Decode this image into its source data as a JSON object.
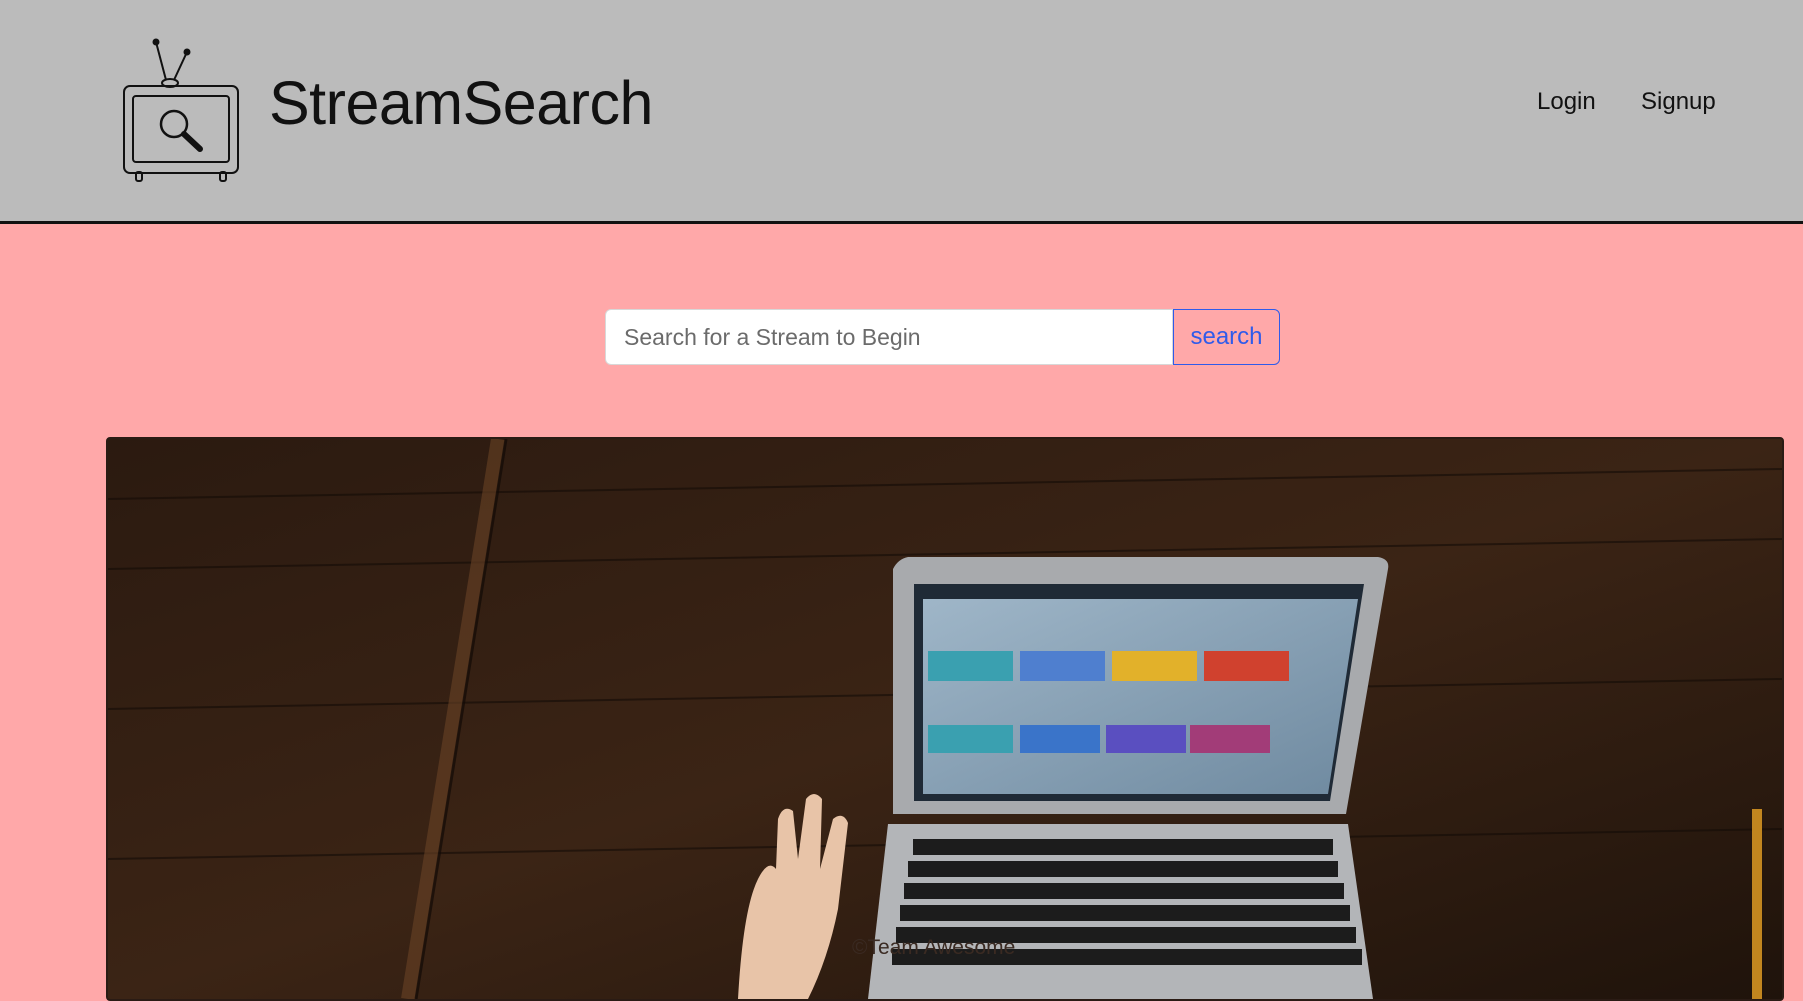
{
  "header": {
    "brand": "StreamSearch",
    "logo_icon": "tv-search-icon",
    "nav": {
      "login": "Login",
      "signup": "Signup"
    }
  },
  "search": {
    "placeholder": "Search for a Stream to Begin",
    "value": "",
    "button_label": "search"
  },
  "hero": {
    "image": "laptop-on-wooden-desk-photo"
  },
  "footer": {
    "text": "©Team Awesome"
  },
  "colors": {
    "header_bg": "#bbbbbb",
    "page_bg": "#ffa8a9",
    "accent": "#2f5bea"
  }
}
